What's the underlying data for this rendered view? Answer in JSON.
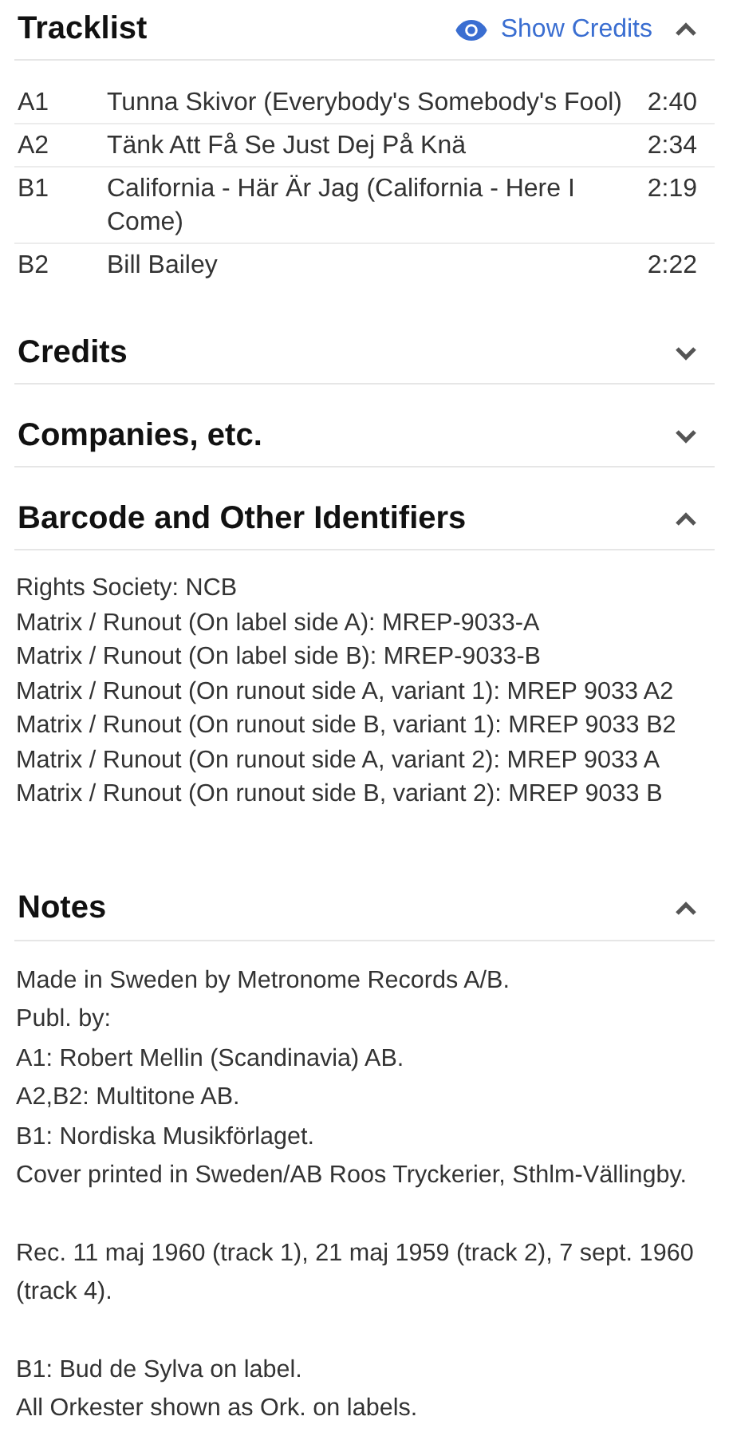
{
  "sections": [
    {
      "kind": "tracklist",
      "title": "Tracklist",
      "expanded": true,
      "show_credits": "Show Credits",
      "tracks": [
        {
          "position": "A1",
          "title": "Tunna Skivor (Everybody's Somebody's Fool)",
          "duration": "2:40"
        },
        {
          "position": "A2",
          "title": "Tänk Att Få Se Just Dej På Knä",
          "duration": "2:34"
        },
        {
          "position": "B1",
          "title": "California - Här Är Jag (California - Here I Come)",
          "duration": "2:19"
        },
        {
          "position": "B2",
          "title": "Bill Bailey",
          "duration": "2:22"
        }
      ]
    },
    {
      "title": "Credits",
      "expanded": false
    },
    {
      "title": "Companies, etc.",
      "expanded": false
    },
    {
      "kind": "identifiers",
      "title": "Barcode and Other Identifiers",
      "expanded": true,
      "lines": [
        "Rights Society: NCB",
        "Matrix / Runout (On label side A): MREP-9033-A",
        "Matrix / Runout (On label side B): MREP-9033-B",
        "Matrix / Runout (On runout side A, variant 1): MREP 9033 A2",
        "Matrix / Runout (On runout side B, variant 1): MREP 9033 B2",
        "Matrix / Runout (On runout side A, variant 2): MREP 9033 A",
        "Matrix / Runout (On runout side B, variant 2): MREP 9033 B"
      ]
    },
    {
      "kind": "notes",
      "title": "Notes",
      "expanded": true,
      "paragraphs": [
        [
          "Made in Sweden by Metronome Records A/B.",
          "Publ. by:",
          "A1: Robert Mellin (Scandinavia) AB.",
          "A2,B2: Multitone AB.",
          "B1: Nordiska Musikförlaget.",
          "Cover printed in Sweden/AB Roos Tryckerier, Sthlm-Vällingby."
        ],
        [
          "Rec. 11 maj 1960 (track 1), 21 maj 1959 (track 2), 7 sept. 1960 (track 4)."
        ],
        [
          "B1: Bud de Sylva on label.",
          "All Orkester shown as Ork. on labels."
        ]
      ]
    }
  ]
}
